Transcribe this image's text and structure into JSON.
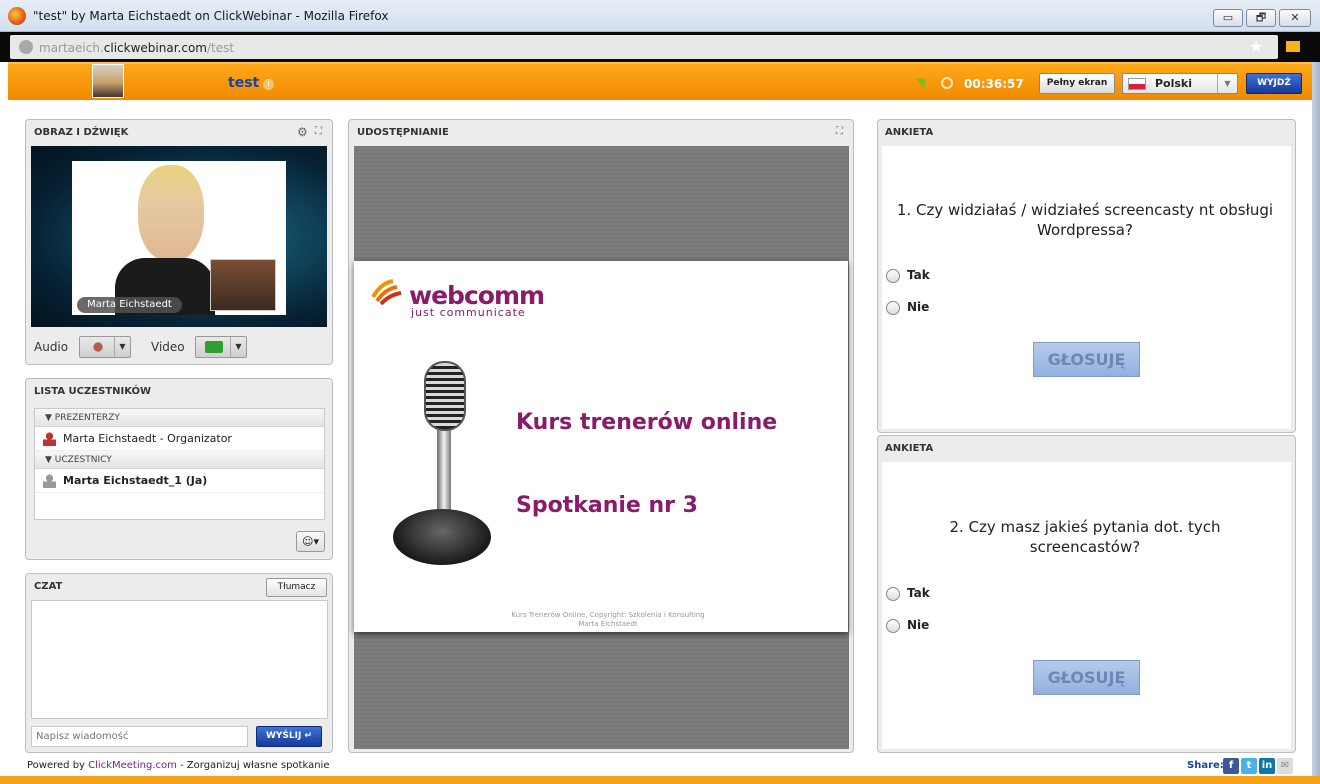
{
  "window": {
    "title": "\"test\" by Marta Eichstaedt on ClickWebinar - Mozilla Firefox",
    "min": "▭",
    "max": "🗗",
    "close": "✕"
  },
  "browser": {
    "url_prefix": "martaeich.",
    "url_domain": "clickwebinar.com",
    "url_path": "/test"
  },
  "header": {
    "meeting_title": "test",
    "timer": "00:36:57",
    "fullscreen_label": "Pełny ekran",
    "language": "Polski",
    "exit_label": "WYJDŹ"
  },
  "video_panel": {
    "title": "OBRAZ I DŹWIĘK",
    "presenter_name": "Marta Eichstaedt",
    "audio_label": "Audio",
    "video_label": "Video"
  },
  "participants": {
    "title": "LISTA UCZESTNIKÓW",
    "groups": [
      {
        "label": "PREZENTERZY",
        "members": [
          "Marta Eichstaedt - Organizator"
        ]
      },
      {
        "label": "UCZESTNICY",
        "members": [
          "Marta Eichstaedt_1 (Ja)"
        ]
      }
    ]
  },
  "chat": {
    "title": "CZAT",
    "translate_label": "Tłumacz",
    "input_placeholder": "Napisz wiadomość",
    "send_label": "WYŚLIJ"
  },
  "share_panel": {
    "title": "UDOSTĘPNIANIE",
    "slide": {
      "logo_name": "webcomm",
      "logo_tagline": "just communicate",
      "heading1": "Kurs trenerów online",
      "heading2": "Spotkanie nr 3",
      "footer": "Kurs Trenerów Online, Copyright: Szkolenia i Konsulting Marta Eichstaedt"
    }
  },
  "polls": [
    {
      "title": "ANKIETA",
      "question": "1. Czy widziałaś / widziałeś screencasty nt obsługi Wordpressa?",
      "options": [
        "Tak",
        "Nie"
      ],
      "vote_label": "GŁOSUJĘ"
    },
    {
      "title": "ANKIETA",
      "question": "2. Czy masz jakieś pytania dot. tych screencastów?",
      "options": [
        "Tak",
        "Nie"
      ],
      "vote_label": "GŁOSUJĘ"
    }
  ],
  "footer": {
    "powered_prefix": "Powered by ",
    "powered_link": "ClickMeeting.com",
    "powered_suffix": " - Zorganizuj własne spotkanie",
    "share_label": "Share:"
  },
  "colors": {
    "accent_orange": "#f39200",
    "brand_purple": "#8a1a6a",
    "button_blue": "#1a3fa0"
  }
}
